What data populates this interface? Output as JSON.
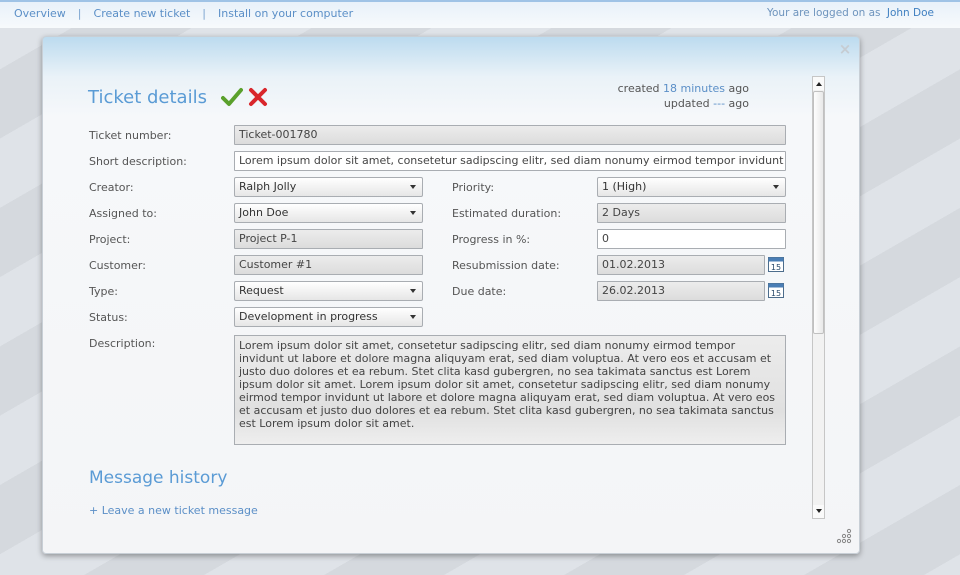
{
  "nav": {
    "overview": "Overview",
    "create_ticket": "Create new ticket",
    "install": "Install on your computer",
    "separator": "|",
    "logged_prefix": "Your are logged on as",
    "user": "John Doe"
  },
  "dialog": {
    "title": "Ticket details",
    "meta": {
      "created_label": "created",
      "created_value": "18 minutes",
      "created_suffix": "ago",
      "updated_label": "updated",
      "updated_value": "---",
      "updated_suffix": "ago"
    },
    "labels": {
      "ticket_number": "Ticket number:",
      "short_description": "Short description:",
      "creator": "Creator:",
      "assigned_to": "Assigned to:",
      "project": "Project:",
      "customer": "Customer:",
      "type": "Type:",
      "status": "Status:",
      "description": "Description:",
      "priority": "Priority:",
      "estimated_duration": "Estimated duration:",
      "progress": "Progress in %:",
      "resubmission_date": "Resubmission date:",
      "due_date": "Due date:"
    },
    "values": {
      "ticket_number": "Ticket-001780",
      "short_description": "Lorem ipsum dolor sit amet, consetetur sadipscing elitr, sed diam nonumy eirmod tempor invidunt ut labore.",
      "creator": "Ralph Jolly",
      "assigned_to": "John Doe",
      "project": "Project P-1",
      "customer": "Customer #1",
      "type": "Request",
      "status": "Development in progress",
      "priority": "1 (High)",
      "estimated_duration": "2 Days",
      "progress": "0",
      "resubmission_date": "01.02.2013",
      "due_date": "26.02.2013",
      "description": "Lorem ipsum dolor sit amet, consetetur sadipscing elitr, sed diam nonumy eirmod tempor invidunt ut labore et dolore magna aliquyam erat, sed diam voluptua. At vero eos et accusam et justo duo dolores et ea rebum. Stet clita kasd gubergren, no sea takimata sanctus est Lorem ipsum dolor sit amet. Lorem ipsum dolor sit amet, consetetur sadipscing elitr, sed diam nonumy eirmod tempor invidunt ut labore et dolore magna aliquyam erat, sed diam voluptua. At vero eos et accusam et justo duo dolores et ea rebum. Stet clita kasd gubergren, no sea takimata sanctus est Lorem ipsum dolor sit amet."
    },
    "calendar_day": "15",
    "history_title": "Message history",
    "history_link": "+ Leave a new ticket message",
    "close_glyph": "×"
  },
  "colors": {
    "accent": "#5a9bd5",
    "link": "#5b8fc7",
    "confirm": "#5aa02c",
    "cancel": "#d9262b"
  },
  "icons": [
    "check-icon",
    "cross-icon",
    "calendar-icon",
    "close-icon",
    "resize-grip-icon"
  ]
}
